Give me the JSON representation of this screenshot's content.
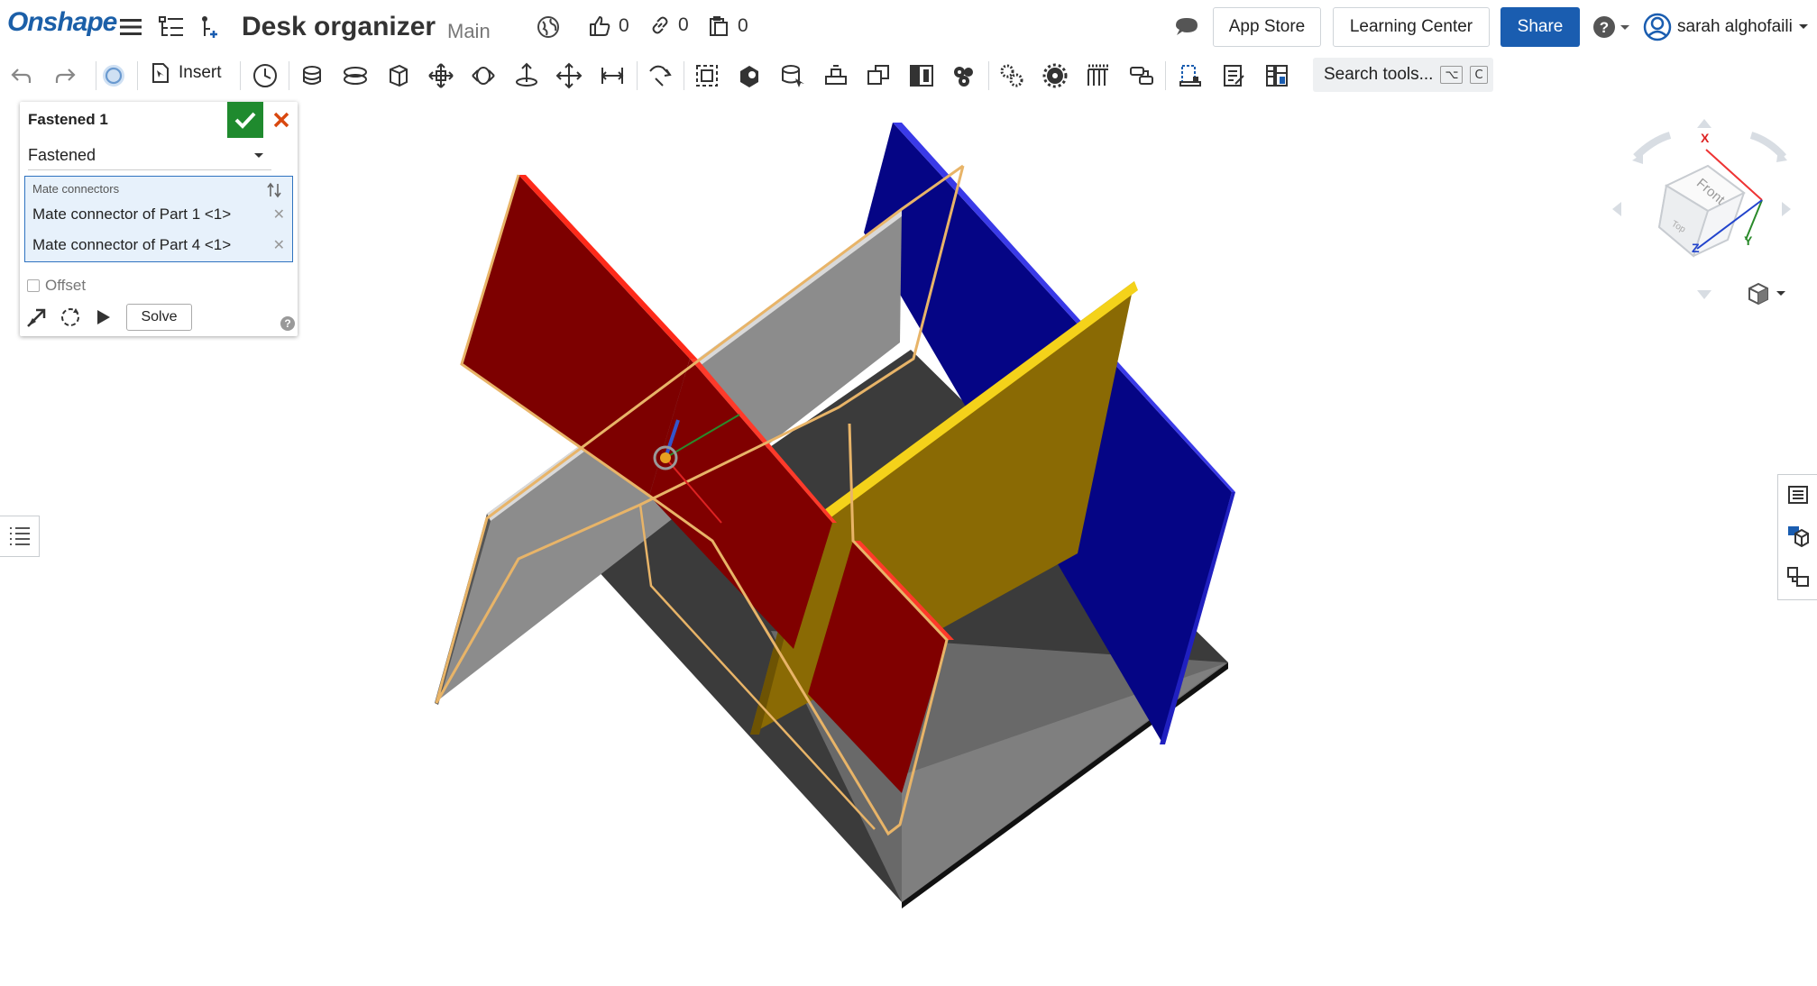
{
  "app": {
    "logo": "Onshape"
  },
  "document": {
    "title": "Desk organizer",
    "branch": "Main"
  },
  "counters": {
    "likes": "0",
    "links": "0",
    "copies": "0"
  },
  "header_buttons": {
    "app_store": "App Store",
    "learning_center": "Learning Center",
    "share": "Share"
  },
  "user": {
    "name": "sarah alghofaili"
  },
  "toolbar": {
    "insert_label": "Insert",
    "search_label": "Search tools...",
    "search_shortcut_1": "⌥",
    "search_shortcut_2": "C",
    "tools": [
      "undo-icon",
      "redo-icon",
      "replicate-icon",
      "insert-icon",
      "history-icon",
      "mate-connector-icon",
      "fastened-mate-icon",
      "revolute-mate-icon",
      "slider-mate-icon",
      "planar-mate-icon",
      "cylindrical-mate-icon",
      "pin-slot-mate-icon",
      "ball-mate-icon",
      "parallel-mate-icon",
      "tangent-mate-icon",
      "group-icon",
      "fix-icon",
      "mate-feature-icon",
      "relation-icon",
      "gear-relation-icon",
      "rack-pinion-icon",
      "screw-relation-icon",
      "linear-relation-icon",
      "linear-pattern-icon",
      "circular-pattern-icon",
      "explode-icon",
      "section-view-icon",
      "measure-icon",
      "mass-properties-icon",
      "named-views-icon"
    ]
  },
  "panel": {
    "title": "Fastened 1",
    "mate_type": "Fastened",
    "mates_header": "Mate connectors",
    "mate_1": "Mate connector of Part 1 <1>",
    "mate_2": "Mate connector of Part 4 <1>",
    "offset_label": "Offset",
    "offset_checked": false,
    "solve_label": "Solve",
    "help_label": "?"
  },
  "viewcube": {
    "face_label": "Front",
    "top_label": "Top",
    "axis_x": "X",
    "axis_y": "Y",
    "axis_z": "Z"
  },
  "colors": {
    "brand": "#1b5fa8",
    "share": "#1a5db0",
    "ok": "#1f8a2e",
    "cancel": "#d9480f",
    "red_part": "#8b0000",
    "blue_part": "#0a0a8f",
    "yellow_part": "#9a7a08",
    "gray_part": "#8a8a8a",
    "base": "#3a3a3a",
    "highlight": "#e8b468"
  }
}
